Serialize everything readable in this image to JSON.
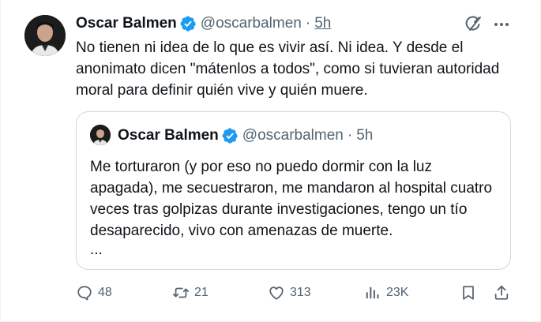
{
  "tweet": {
    "author_name": "Oscar Balmen",
    "handle": "@oscarbalmen",
    "separator": "·",
    "time": "5h",
    "text": "No tienen ni idea de lo que es vivir así. Ni idea. Y desde el anonimato dicen \"mátenlos a todos\", como si tuvieran autoridad moral para definir quién vive y quién muere."
  },
  "quote": {
    "author_name": "Oscar Balmen",
    "handle": "@oscarbalmen",
    "separator": "·",
    "time": "5h",
    "text": "Me torturaron (y por eso no puedo dormir con la luz apagada), me secuestraron, me mandaron al hospital cuatro veces tras golpizas durante investigaciones, tengo un tío desaparecido, vivo con amenazas de muerte.",
    "ellipsis": "..."
  },
  "actions": {
    "replies": "48",
    "reposts": "21",
    "likes": "313",
    "views": "23K"
  },
  "icons": {
    "verified": "verified-badge-icon",
    "grok": "grok-icon",
    "more": "more-icon",
    "reply": "reply-icon",
    "repost": "repost-icon",
    "like": "like-icon",
    "views": "views-icon",
    "bookmark": "bookmark-icon",
    "share": "share-icon"
  },
  "colors": {
    "text_primary": "#0f1419",
    "text_secondary": "#536471",
    "verified_blue": "#1d9bf0",
    "border": "#cfd9de"
  }
}
